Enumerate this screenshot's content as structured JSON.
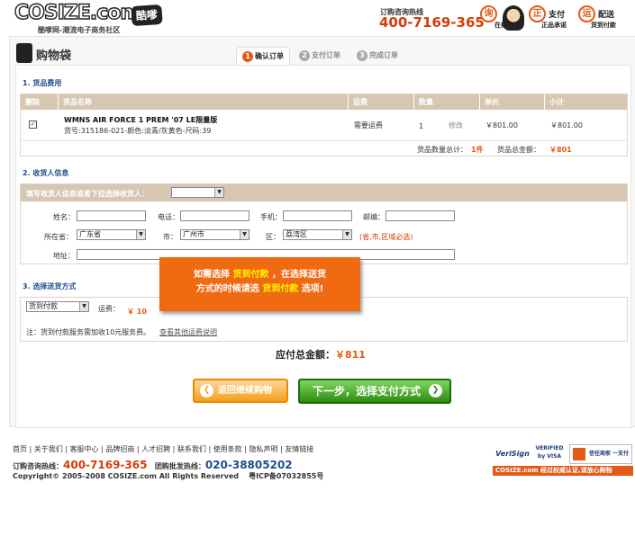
{
  "header": {
    "logo": "COSIZE.com",
    "logo_cool": "酷嗲",
    "tagline": "酷嗲网-潮流电子商务社区",
    "hotline_label": "订购咨询热线",
    "hotline_number": "400-7169-365",
    "services": [
      {
        "char": "询",
        "line1": "",
        "line2": "在线客服"
      },
      {
        "char": "正",
        "line1": "支付",
        "line2": "正品承诺"
      },
      {
        "char": "运",
        "line1": "配送",
        "line2": "货到付款"
      }
    ]
  },
  "page": {
    "title": "购物袋",
    "steps": [
      {
        "num": "1",
        "label": "确认订单"
      },
      {
        "num": "2",
        "label": "支付订单"
      },
      {
        "num": "3",
        "label": "完成订单"
      }
    ]
  },
  "goods": {
    "section": "1. 货品费用",
    "headers": [
      "删除",
      "货品名称",
      "运费",
      "数量",
      "单价",
      "小计"
    ],
    "item": {
      "checked": "✓",
      "name": "WMNS AIR FORCE 1 PREM '07 LE限量版",
      "detail": "货号:315186-021-颜色:淡青/灰黄色-尺码:39",
      "shipping": "需要运费",
      "qty": "1",
      "edit": "修改",
      "price": "￥801.00",
      "subtotal": "￥801.00"
    },
    "summary_count_label": "货品数量总计：",
    "summary_count": "1件",
    "summary_amount_label": "货品总金额：",
    "summary_amount": "￥801"
  },
  "receiver": {
    "section": "2. 收货人信息",
    "prompt": "填写收货人信息或者下拉选择收货人：",
    "name": "姓名：",
    "phone": "电话：",
    "mobile": "手机：",
    "zip": "邮编：",
    "province_label": "所在省：",
    "province": "广东省",
    "city_label": "市：",
    "city": "广州市",
    "district_label": "区：",
    "district": "荔湾区",
    "required_note": "(省,市,区域必选)",
    "address": "地址："
  },
  "shipping": {
    "section": "3. 选择送货方式",
    "method": "货到付款",
    "fee_label": "运费：",
    "fee": "￥ 10",
    "note": "注：货到付款服务需加收10元服务费。",
    "note_link": "查看其他运费说明"
  },
  "tooltip": {
    "a": "如需选择",
    "b": "货到付款",
    "c": "，在选择送货",
    "d": "方式的时候请选",
    "e": "货到付款",
    "f": "选项!"
  },
  "total": {
    "label": "应付总金额：",
    "value": "￥811"
  },
  "buttons": {
    "back": "返回继续购物",
    "next": "下一步，选择支付方式"
  },
  "footer": {
    "links": [
      "首页",
      "关于我们",
      "客服中心",
      "品牌招商",
      "人才招聘",
      "联系我们",
      "使用条款",
      "隐私声明",
      "友情链接"
    ],
    "hotline_label": "订购咨询热线：",
    "hotline": "400-7169-365",
    "wholesale_label": "团购批发热线：",
    "wholesale": "020-38805202",
    "copyright": "Copyright© 2005-2008 COSIZE.com All Rights Reserved",
    "icp": "粤ICP备07032855号",
    "badges": [
      "VeriSign",
      "VERIFIED by VISA",
      "信任商家 一支付宝"
    ],
    "cert": "COSIZE.com 经过权威认证,请放心购物"
  }
}
